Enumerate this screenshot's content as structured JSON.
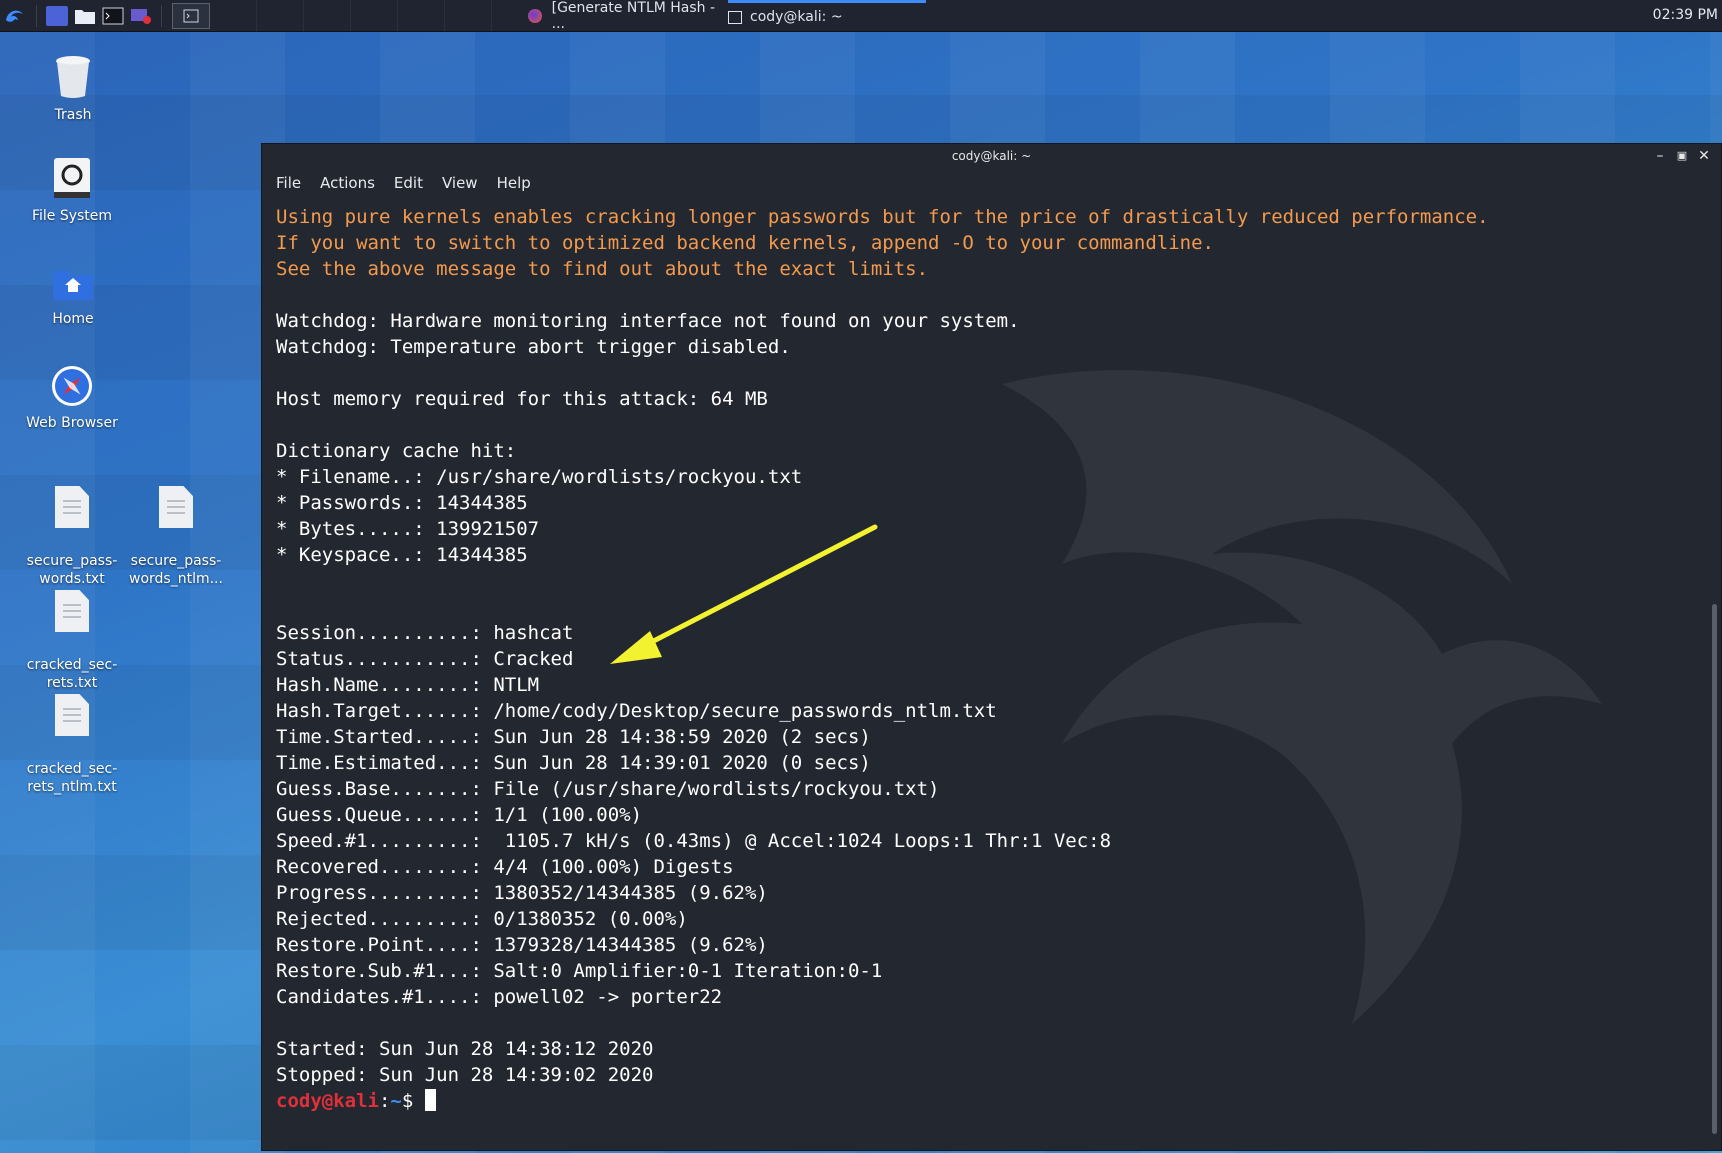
{
  "panel": {
    "tasks": [
      {
        "label": "[Generate NTLM Hash - ..."
      },
      {
        "label": "cody@kali: ~"
      }
    ],
    "clock": "02:39 PM"
  },
  "desktop": {
    "icons": [
      {
        "label": "Trash"
      },
      {
        "label": "File System"
      },
      {
        "label": "Home"
      },
      {
        "label": "Web Browser"
      },
      {
        "label": "secure_pass-\nwords.txt"
      },
      {
        "label": "secure_pass-\nwords_ntlm..."
      },
      {
        "label": "cracked_sec-\nrets.txt"
      },
      {
        "label": "cracked_sec-\nrets_ntlm.txt"
      }
    ]
  },
  "terminal": {
    "title": "cody@kali: ~",
    "menu": [
      "File",
      "Actions",
      "Edit",
      "View",
      "Help"
    ],
    "warn_lines": [
      "Using pure kernels enables cracking longer passwords but for the price of drastically reduced performance.",
      "If you want to switch to optimized backend kernels, append -O to your commandline.",
      "See the above message to find out about the exact limits."
    ],
    "lines": [
      "",
      "Watchdog: Hardware monitoring interface not found on your system.",
      "Watchdog: Temperature abort trigger disabled.",
      "",
      "Host memory required for this attack: 64 MB",
      "",
      "Dictionary cache hit:",
      "* Filename..: /usr/share/wordlists/rockyou.txt",
      "* Passwords.: 14344385",
      "* Bytes.....: 139921507",
      "* Keyspace..: 14344385",
      "",
      "",
      "Session..........: hashcat",
      "Status...........: Cracked",
      "Hash.Name........: NTLM",
      "Hash.Target......: /home/cody/Desktop/secure_passwords_ntlm.txt",
      "Time.Started.....: Sun Jun 28 14:38:59 2020 (2 secs)",
      "Time.Estimated...: Sun Jun 28 14:39:01 2020 (0 secs)",
      "Guess.Base.......: File (/usr/share/wordlists/rockyou.txt)",
      "Guess.Queue......: 1/1 (100.00%)",
      "Speed.#1.........:  1105.7 kH/s (0.43ms) @ Accel:1024 Loops:1 Thr:1 Vec:8",
      "Recovered........: 4/4 (100.00%) Digests",
      "Progress.........: 1380352/14344385 (9.62%)",
      "Rejected.........: 0/1380352 (0.00%)",
      "Restore.Point....: 1379328/14344385 (9.62%)",
      "Restore.Sub.#1...: Salt:0 Amplifier:0-1 Iteration:0-1",
      "Candidates.#1....: powell02 -> porter22",
      "",
      "Started: Sun Jun 28 14:38:12 2020",
      "Stopped: Sun Jun 28 14:39:02 2020"
    ],
    "prompt_user": "cody@kali",
    "prompt_sep": ":",
    "prompt_path": "~",
    "prompt_symbol": "$ "
  },
  "colors": {
    "warning_text": "#f39a4e",
    "prompt_user": "#e0303a",
    "prompt_path": "#3b8eea",
    "annotation_arrow": "#f2f230",
    "terminal_bg": "#23272f"
  }
}
